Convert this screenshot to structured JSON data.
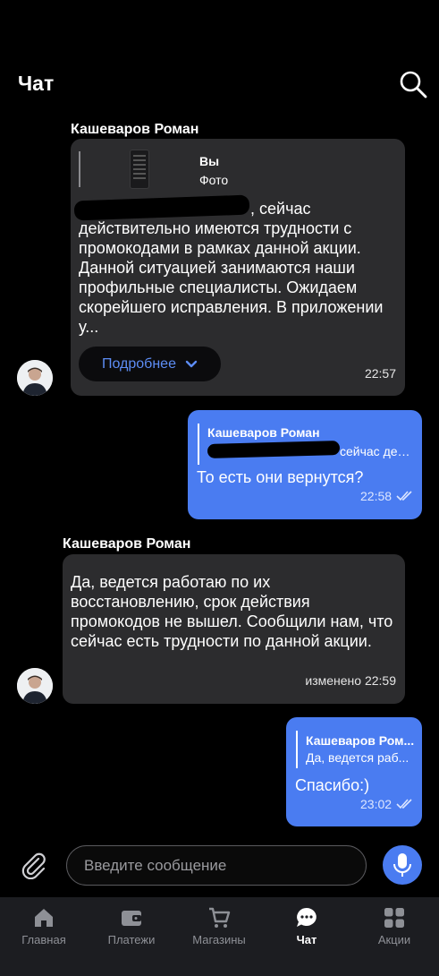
{
  "header": {
    "title": "Чат",
    "search_icon": "search-icon"
  },
  "messages": [
    {
      "sender": "Кашеваров Роман",
      "reply": {
        "name": "Вы",
        "text": "Фото"
      },
      "text_line1_tail": ", сейчас",
      "text_rest": "действительно имеются трудности с промокодами в рамках данной акции. Данной ситуацией занимаются наши профильные специалисты. Ожидаем скорейшего исправления. В приложении у...",
      "more_label": "Подробнее",
      "time": "22:57"
    },
    {
      "reply": {
        "name": "Кашеваров Роман",
        "text": "сейчас дей..."
      },
      "text": "То есть они вернутся?",
      "time": "22:58"
    },
    {
      "sender": "Кашеваров Роман",
      "text": "Да, ведется работаю по их восстановлению, срок действия промокодов не вышел. Сообщили нам, что сейчас есть трудности по данной акции.",
      "time": "изменено 22:59"
    },
    {
      "reply": {
        "name": "Кашеваров Ром...",
        "text": "Да, ведется раб..."
      },
      "text": "Спасибо:)",
      "time": "23:02"
    }
  ],
  "composer": {
    "placeholder": "Введите сообщение"
  },
  "nav": {
    "items": [
      {
        "label": "Главная",
        "icon": "home-icon"
      },
      {
        "label": "Платежи",
        "icon": "wallet-icon"
      },
      {
        "label": "Магазины",
        "icon": "cart-icon"
      },
      {
        "label": "Чат",
        "icon": "chat-icon",
        "active": true
      },
      {
        "label": "Акции",
        "icon": "grid-icon"
      }
    ]
  },
  "colors": {
    "accent": "#4a7cf1",
    "incoming_bubble": "#2c2c2e",
    "nav_bg": "#1c1d21",
    "link": "#5d8df5"
  }
}
